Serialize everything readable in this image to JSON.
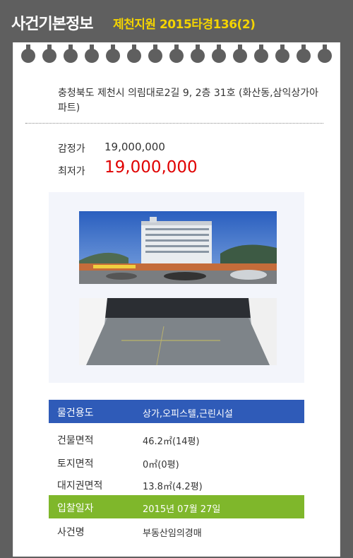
{
  "header": {
    "title": "사건기본정보",
    "case_label": "제천지원 2015타경136(2)"
  },
  "address": "충청북도 제천시 의림대로2길 9, 2층 31호 (화산동,삼익상가아파트)",
  "prices": {
    "appraisal_label": "감정가",
    "appraisal_value": "19,000,000",
    "minimum_label": "최저가",
    "minimum_value": "19,000,000"
  },
  "colors": {
    "header_bg": "#5f5f5f",
    "case_accent": "#f4d400",
    "minimum_price": "#e00000",
    "usage_row": "#2f5bb8",
    "bid_date_row": "#7fb72b"
  },
  "info": {
    "usage_label": "물건용도",
    "usage_value": "상가,오피스텔,근린시설",
    "building_area_label": "건물면적",
    "building_area_value": "46.2㎡(14평)",
    "land_area_label": "토지면적",
    "land_area_value": "0㎡(0평)",
    "land_right_label": "대지권면적",
    "land_right_value": "13.8㎡(4.2평)",
    "bid_date_label": "입찰일자",
    "bid_date_value": "2015년 07월 27일",
    "case_name_label": "사건명",
    "case_name_value": "부동산임의경매"
  }
}
